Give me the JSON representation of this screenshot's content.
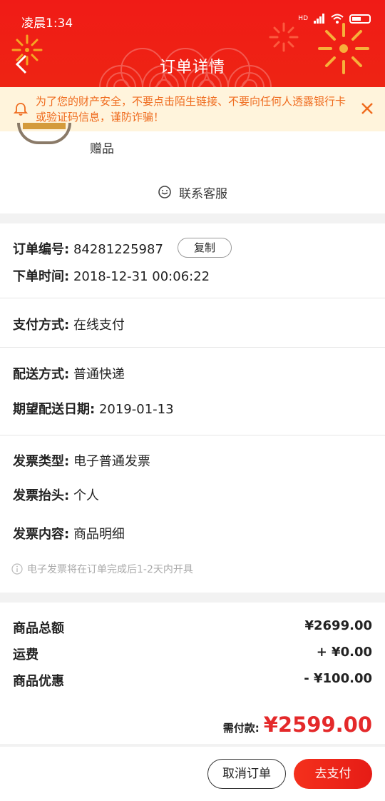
{
  "status_bar": {
    "time": "凌晨1:34",
    "hd": "HD"
  },
  "header": {
    "title": "订单详情"
  },
  "warning": {
    "text": "为了您的财产安全，不要点击陌生链接、不要向任何人透露银行卡或验证码信息，谨防诈骗！"
  },
  "gift": {
    "label": "赠品"
  },
  "customer_service": {
    "label": "联系客服"
  },
  "order": {
    "number_label": "订单编号:",
    "number_value": "84281225987",
    "copy_label": "复制",
    "time_label": "下单时间:",
    "time_value": "2018-12-31 00:06:22",
    "payment_label": "支付方式:",
    "payment_value": "在线支付",
    "delivery_label": "配送方式:",
    "delivery_value": "普通快递",
    "expected_label": "期望配送日期:",
    "expected_value": "2019-01-13",
    "invoice_type_label": "发票类型:",
    "invoice_type_value": "电子普通发票",
    "invoice_title_label": "发票抬头:",
    "invoice_title_value": "个人",
    "invoice_content_label": "发票内容:",
    "invoice_content_value": "商品明细",
    "invoice_note": "电子发票将在订单完成后1-2天内开具"
  },
  "pricing": {
    "subtotal_label": "商品总额",
    "subtotal_value": "¥2699.00",
    "shipping_label": "运费",
    "shipping_value": "+ ¥0.00",
    "discount_label": "商品优惠",
    "discount_value": "- ¥100.00",
    "total_label": "需付款:",
    "total_value": "¥2599.00"
  },
  "footer": {
    "cancel_label": "取消订单",
    "pay_label": "去支付"
  },
  "colors": {
    "brand_red": "#f01b16",
    "price_red": "#e4292a",
    "warning_orange": "#ef6b1e",
    "warning_bg": "#fff4dc"
  },
  "icons": [
    "back-arrow-icon",
    "signal-icon",
    "wifi-icon",
    "battery-icon",
    "bell-icon",
    "close-icon",
    "chat-smile-icon",
    "info-icon"
  ]
}
